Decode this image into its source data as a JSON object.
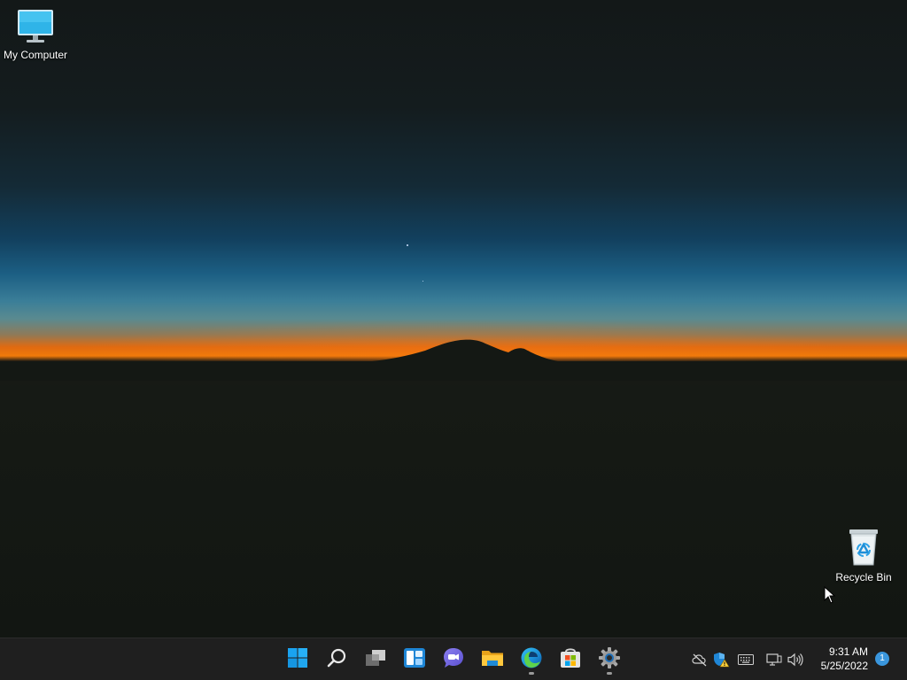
{
  "desktop": {
    "icons": [
      {
        "label": "My Computer",
        "icon": "monitor-icon"
      },
      {
        "label": "Recycle Bin",
        "icon": "recycle-bin-icon"
      }
    ]
  },
  "taskbar": {
    "apps": [
      {
        "name": "Start",
        "icon": "windows-logo-icon"
      },
      {
        "name": "Search",
        "icon": "search-icon"
      },
      {
        "name": "Task View",
        "icon": "task-view-icon"
      },
      {
        "name": "Widgets",
        "icon": "widgets-icon"
      },
      {
        "name": "Chat",
        "icon": "chat-icon"
      },
      {
        "name": "File Explorer",
        "icon": "folder-icon"
      },
      {
        "name": "Microsoft Edge",
        "icon": "edge-icon"
      },
      {
        "name": "Microsoft Store",
        "icon": "store-icon"
      },
      {
        "name": "Settings",
        "icon": "gear-icon"
      }
    ],
    "tray": {
      "icons": [
        "onedrive-offline-icon",
        "security-warning-icon",
        "keyboard-icon",
        "network-icon",
        "volume-icon"
      ],
      "time": "9:31 AM",
      "date": "5/25/2022",
      "notification_count": "1"
    }
  },
  "colors": {
    "taskbar_bg": "#1f1f1f",
    "accent": "#3a96dd"
  }
}
